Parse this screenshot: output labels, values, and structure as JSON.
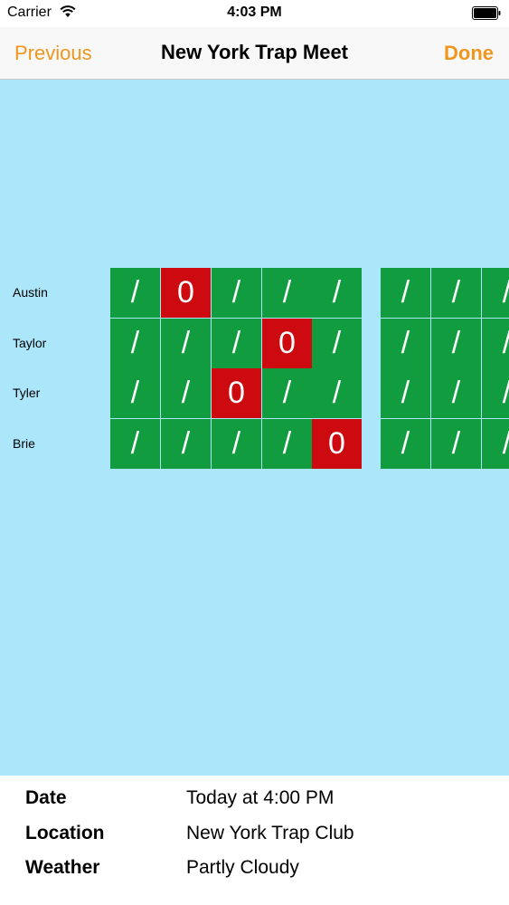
{
  "status_bar": {
    "carrier": "Carrier",
    "time": "4:03 PM"
  },
  "nav": {
    "previous_label": "Previous",
    "title": "New York Trap Meet",
    "done_label": "Done",
    "accent_color": "#f0961e"
  },
  "scoreboard": {
    "background_color": "#ace6fb",
    "hit_color": "#119c3f",
    "miss_color": "#cc0a0f",
    "players": [
      {
        "name": "Austin",
        "round1": [
          "/",
          "0",
          "/",
          "/",
          "/"
        ],
        "round2": [
          "/",
          "/",
          "/"
        ]
      },
      {
        "name": "Taylor",
        "round1": [
          "/",
          "/",
          "/",
          "0",
          "/"
        ],
        "round2": [
          "/",
          "/",
          "/"
        ]
      },
      {
        "name": "Tyler",
        "round1": [
          "/",
          "/",
          "0",
          "/",
          "/"
        ],
        "round2": [
          "/",
          "/",
          "/"
        ]
      },
      {
        "name": "Brie",
        "round1": [
          "/",
          "/",
          "/",
          "/",
          "0"
        ],
        "round2": [
          "/",
          "/",
          "/"
        ]
      }
    ]
  },
  "details": {
    "rows": [
      {
        "label": "Date",
        "value": "Today at 4:00 PM"
      },
      {
        "label": "Location",
        "value": "New York Trap Club"
      },
      {
        "label": "Weather",
        "value": "Partly Cloudy"
      }
    ]
  }
}
